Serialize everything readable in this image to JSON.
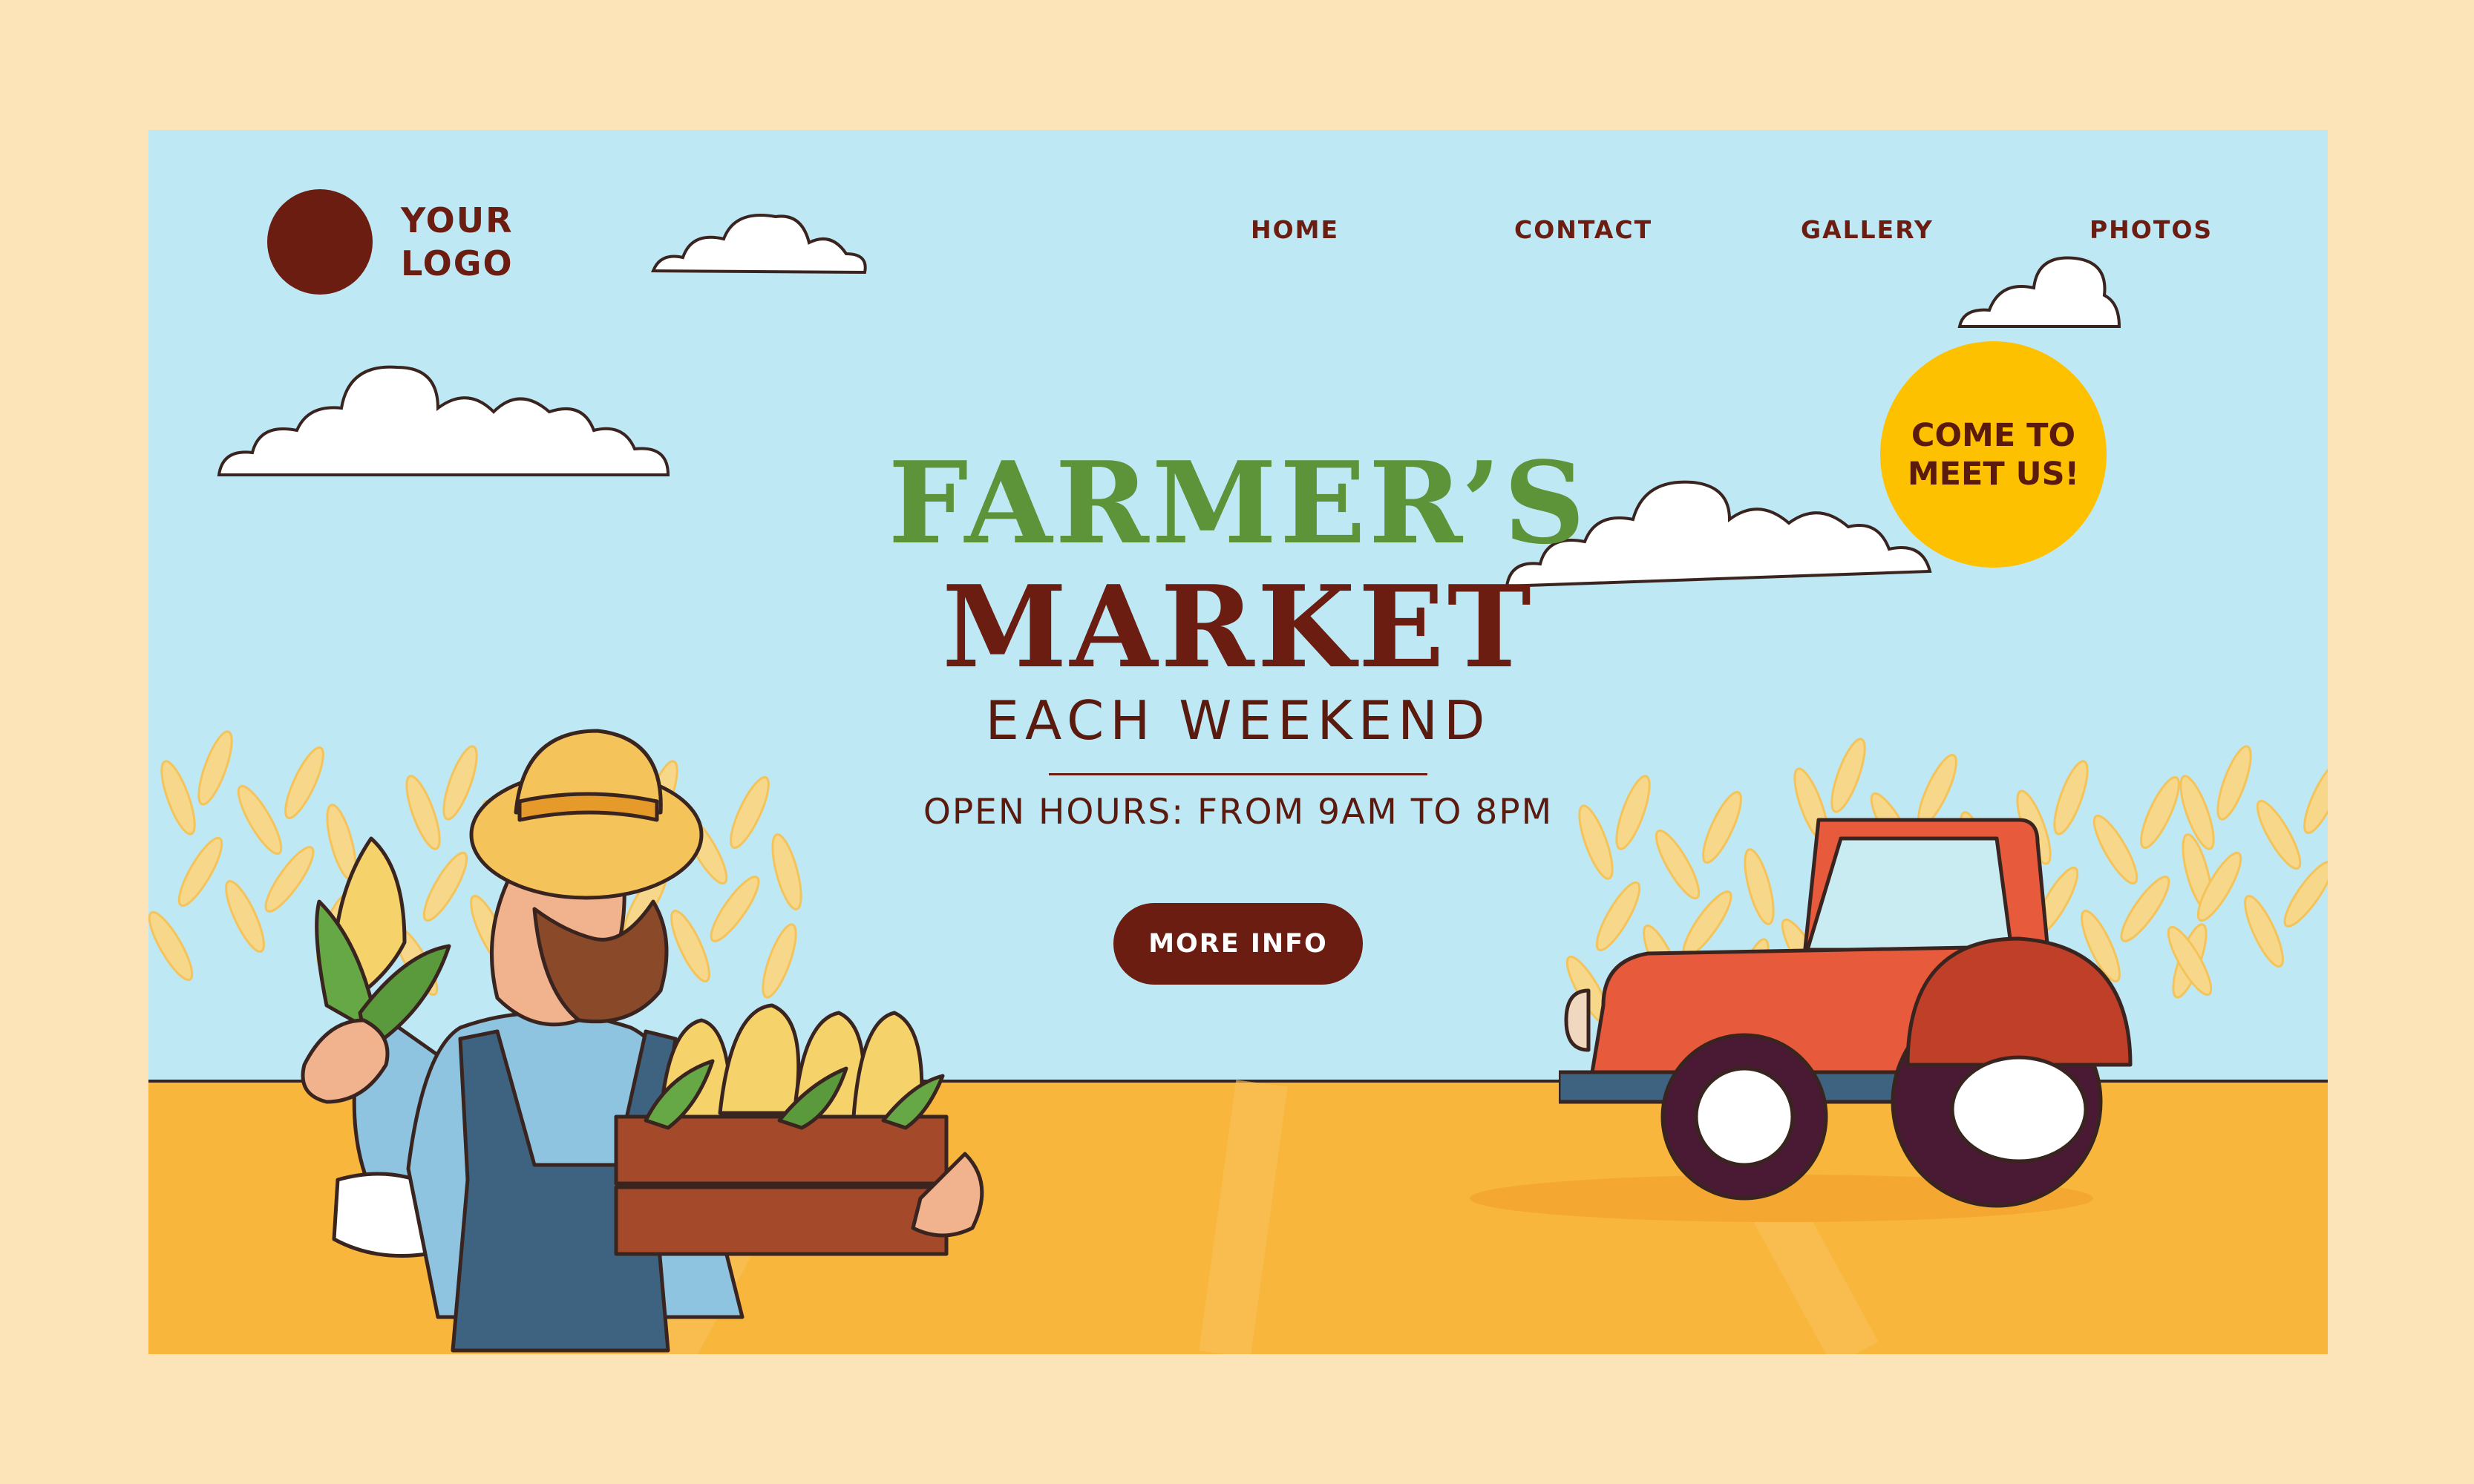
{
  "logo": {
    "line1": "YOUR",
    "line2": "LOGO"
  },
  "nav": {
    "items": [
      "HOME",
      "CONTACT",
      "GALLERY",
      "PHOTOS"
    ]
  },
  "badge": {
    "text": "COME TO\nMEET US!"
  },
  "hero": {
    "title_line1": "FARMER’S",
    "title_line2": "MARKET",
    "subtitle": "EACH WEEKEND",
    "hours": "OPEN HOURS: FROM 9AM TO 8PM",
    "cta_label": "MORE INFO"
  },
  "colors": {
    "sky": "#bfe8f5",
    "ground": "#f8b63c",
    "brand_brown": "#6a1d10",
    "brand_green": "#5d9339",
    "badge_yellow": "#fdc100",
    "tractor_red": "#e85a3c",
    "page_bg": "#fde3b8"
  },
  "icons": [
    "logo-circle",
    "cloud-icon",
    "wheat-plant-icon",
    "farmer-illustration",
    "corn-crate-icon",
    "tractor-icon"
  ]
}
